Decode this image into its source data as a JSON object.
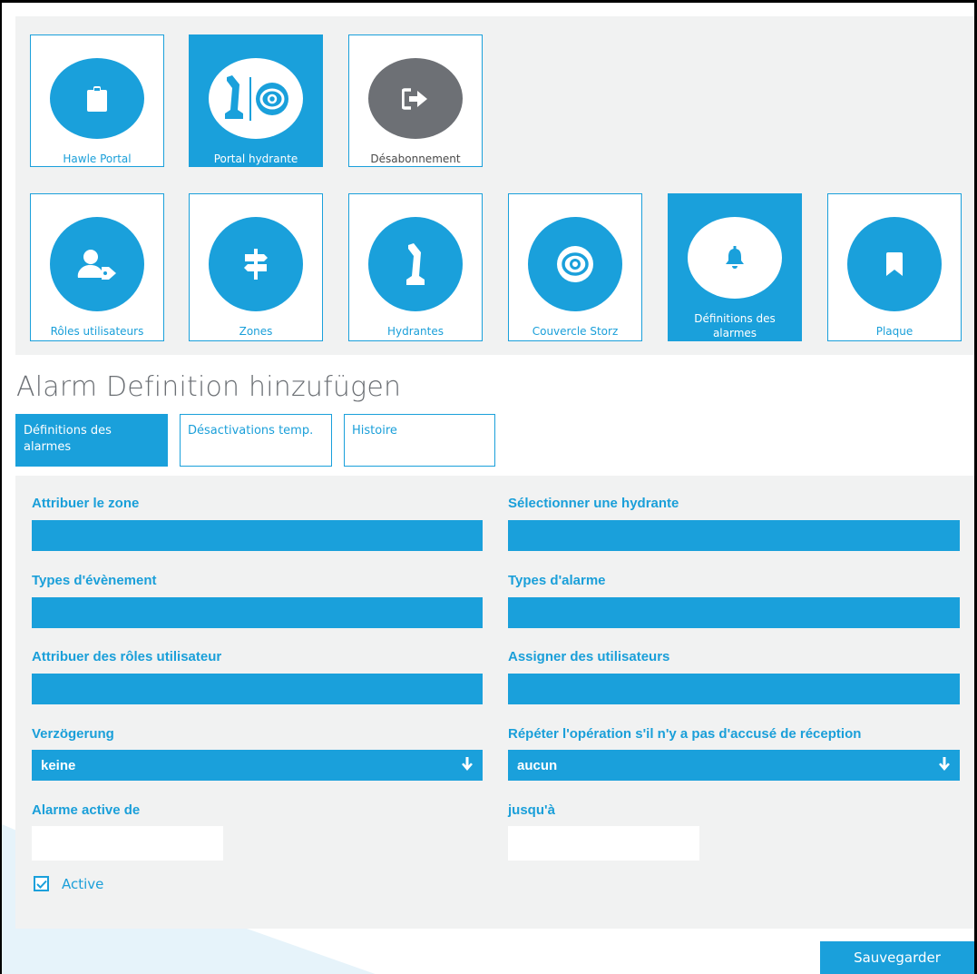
{
  "top_tiles": [
    {
      "label": "Hawle Portal",
      "icon": "clipboard-icon"
    },
    {
      "label": "Portal hydrante",
      "icon": "hydrant-storz-icon",
      "active": true
    },
    {
      "label": "Désabonnement",
      "icon": "sign-out-icon"
    }
  ],
  "module_tiles": [
    {
      "label": "Rôles utilisateurs",
      "icon": "user-tag-icon"
    },
    {
      "label": "Zones",
      "icon": "signpost-icon"
    },
    {
      "label": "Hydrantes",
      "icon": "hydrant-icon"
    },
    {
      "label": "Couvercle Storz",
      "icon": "storz-cover-icon"
    },
    {
      "label": "Définitions des alarmes",
      "icon": "bell-icon",
      "active": true
    },
    {
      "label": "Plaque",
      "icon": "bookmark-icon"
    }
  ],
  "page_title": "Alarm Definition hinzufügen",
  "tabs": [
    {
      "label": "Définitions des alarmes",
      "active": true
    },
    {
      "label": "Désactivations temp."
    },
    {
      "label": "Histoire"
    }
  ],
  "form": {
    "assign_zone_label": "Attribuer le zone",
    "select_hydrant_label": "Sélectionner une hydrante",
    "event_types_label": "Types d'évènement",
    "alarm_types_label": "Types d'alarme",
    "assign_roles_label": "Attribuer des rôles utilisateur",
    "assign_users_label": "Assigner des utilisateurs",
    "delay_label": "Verzögerung",
    "delay_value": "keine",
    "repeat_label": "Répéter l'opération s'il n'y a pas d'accusé de réception",
    "repeat_value": "aucun",
    "active_from_label": "Alarme active de",
    "active_until_label": "jusqu'à",
    "active_checkbox_label": "Active",
    "active_checked": true
  },
  "save_label": "Sauvegarder",
  "colors": {
    "accent": "#1aa0db",
    "panel_bg": "#f1f2f2",
    "logout_grey": "#6d7075",
    "title_grey": "#6b6f74"
  }
}
